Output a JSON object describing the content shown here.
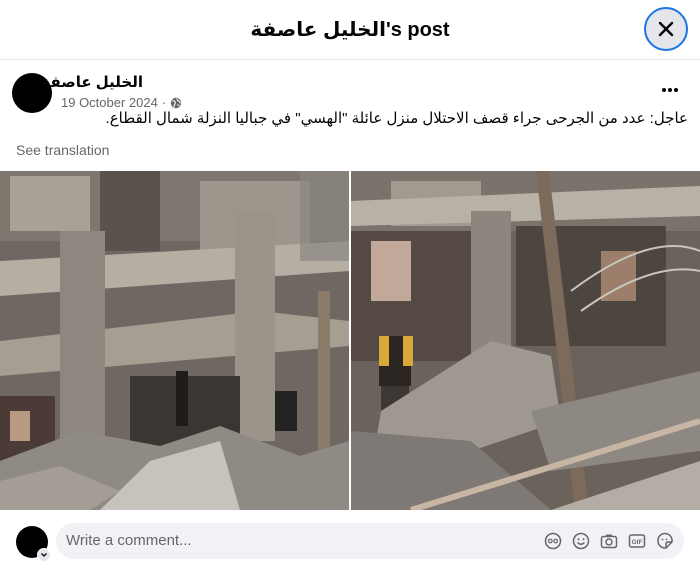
{
  "header": {
    "title": "الخليل عاصفة's post"
  },
  "post": {
    "author": "الخليل عاصفة",
    "date": "19 October 2024",
    "separator": "·",
    "text": "عاجل: عدد من الجرحى جراء قصف الاحتلال منزل عائلة \"الهسي\" في جباليا النزلة شمال القطاع.",
    "see_translation": "See translation",
    "icons": {
      "privacy": "globe-icon",
      "more": "more-dots-icon"
    }
  },
  "photos": [
    {
      "name": "rubble-photo-left"
    },
    {
      "name": "rubble-photo-right"
    }
  ],
  "comment": {
    "placeholder": "Write a comment...",
    "icons": [
      "avatar-sticker-icon",
      "emoji-icon",
      "camera-icon",
      "gif-icon",
      "sticker-icon"
    ]
  },
  "colors": {
    "accent": "#1b74e4",
    "secondary_text": "#65676b",
    "input_bg": "#f0f2f5"
  }
}
